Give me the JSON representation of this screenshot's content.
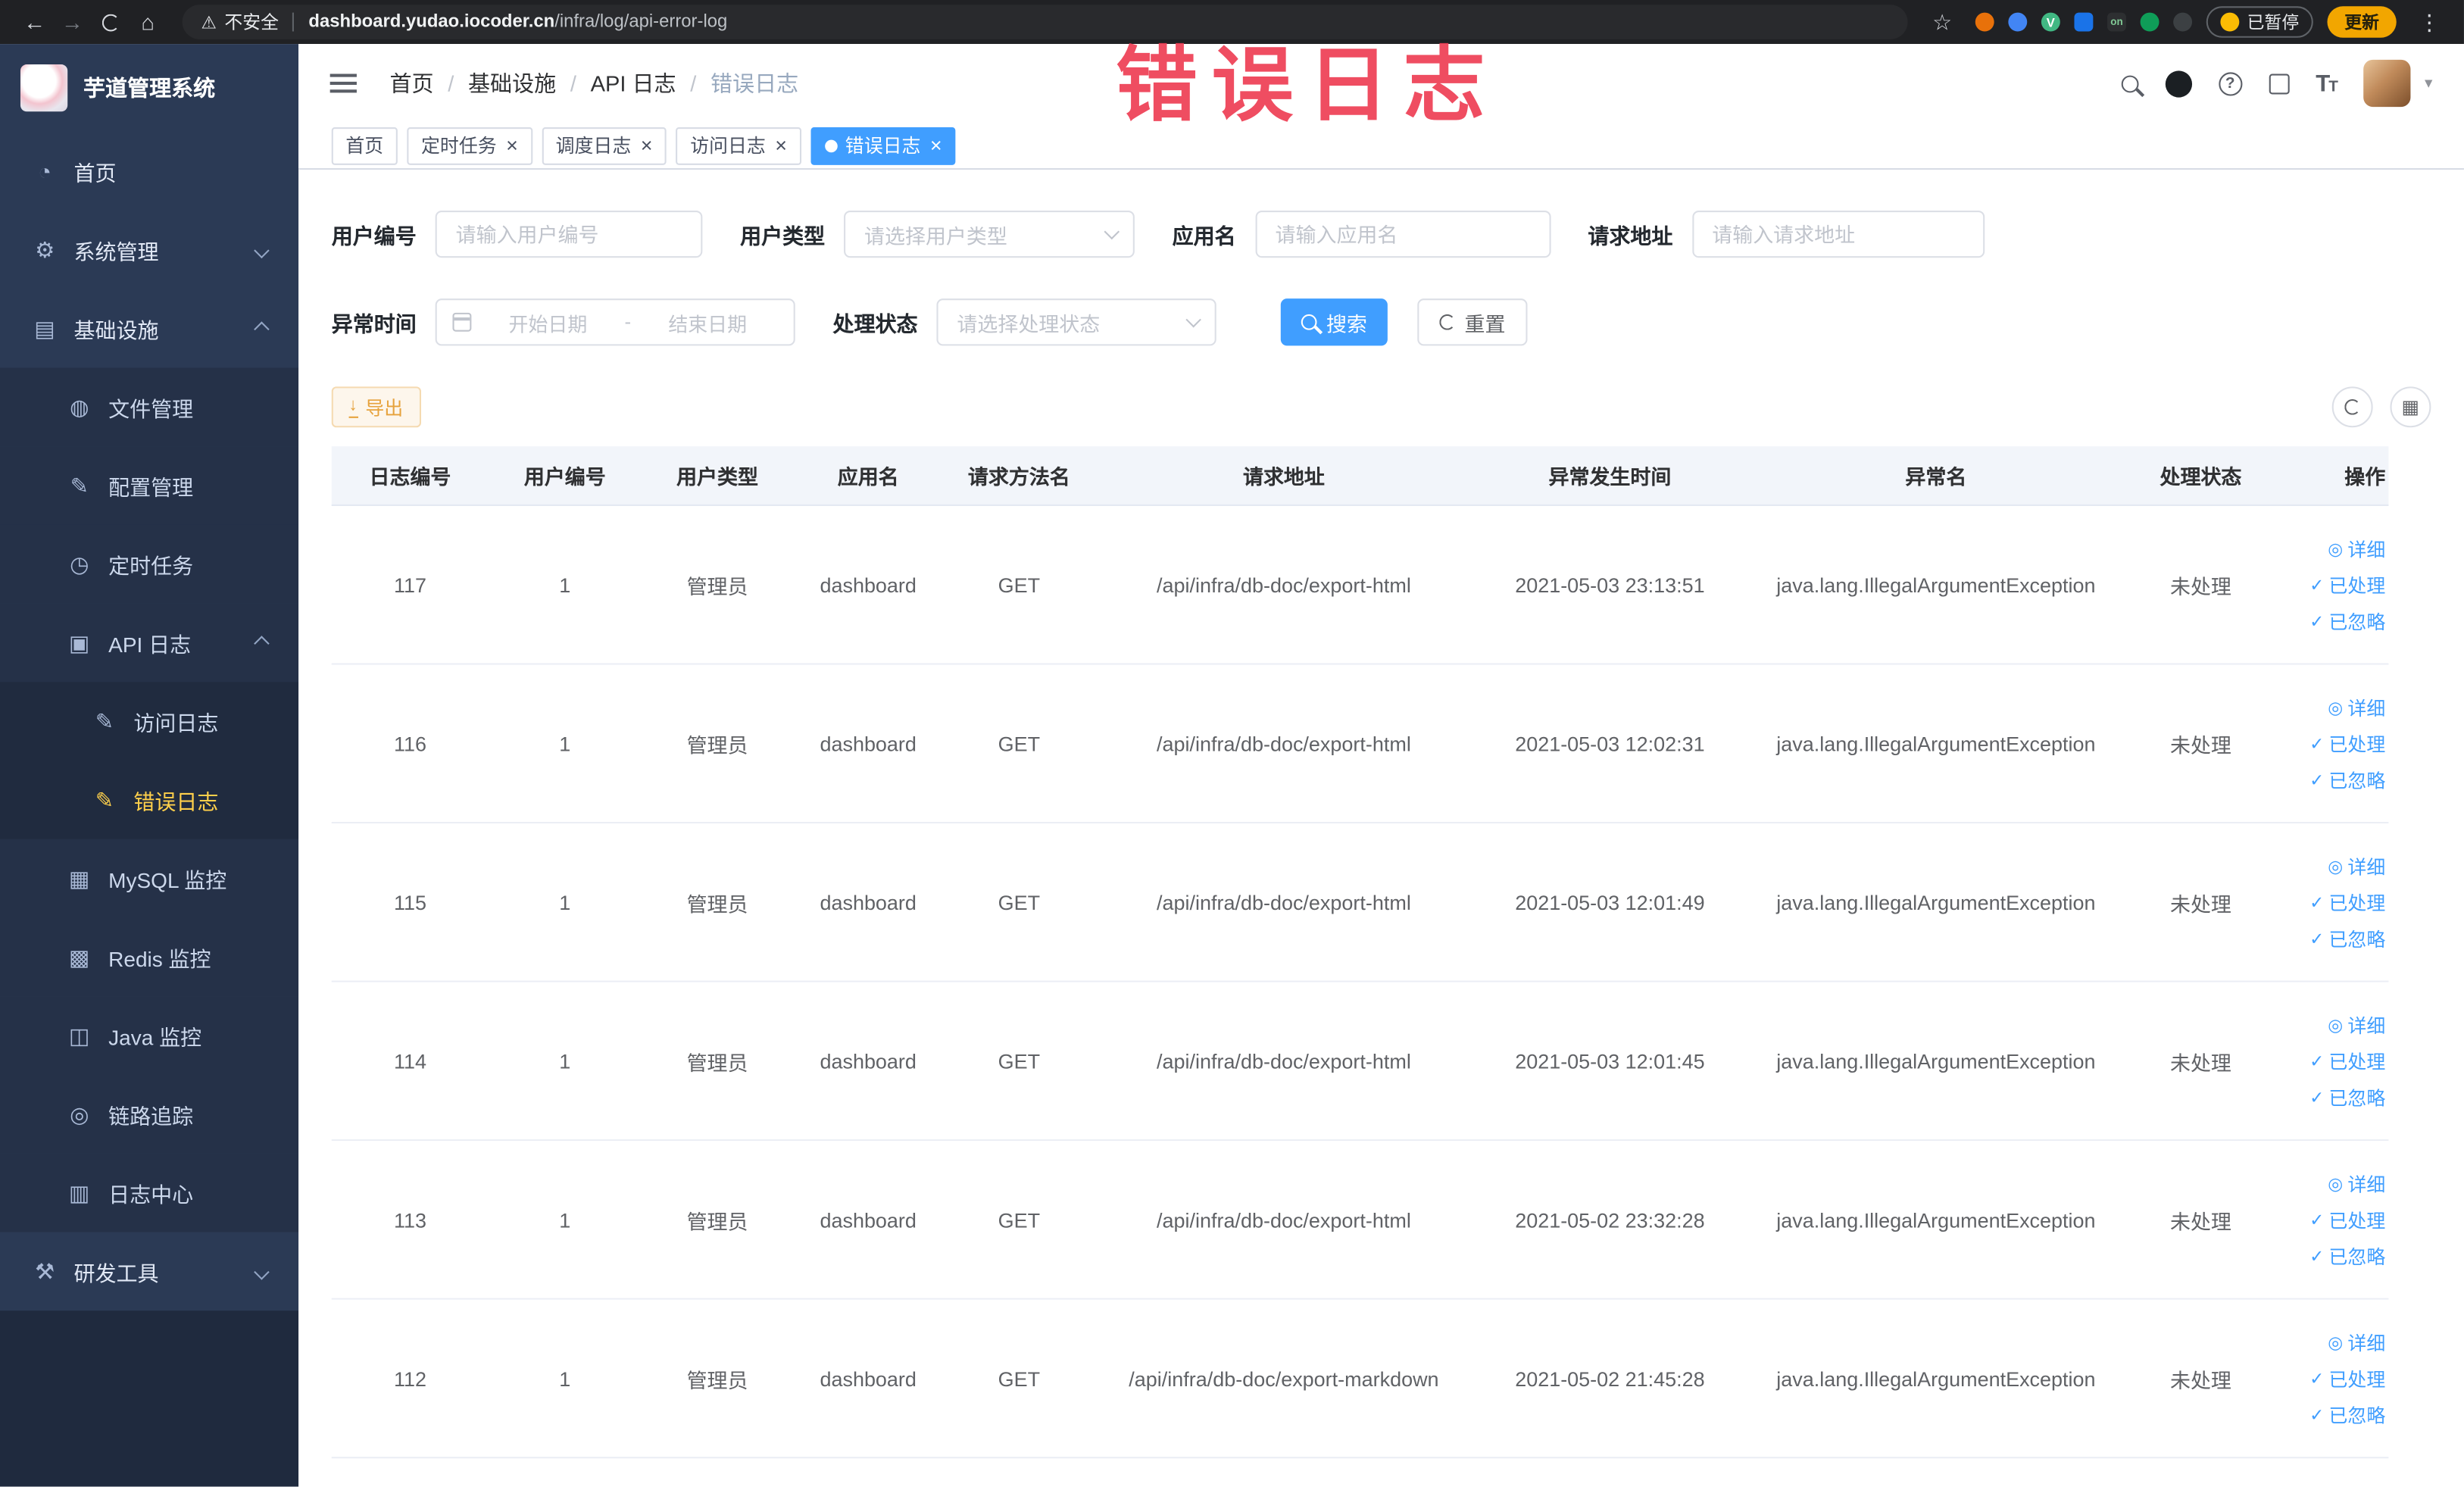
{
  "browser": {
    "security_label": "不安全",
    "url_domain": "dashboard.yudao.iocoder.cn",
    "url_path": "/infra/log/api-error-log",
    "on_badge": "on",
    "paused_label": "已暂停",
    "update_label": "更新"
  },
  "sidebar": {
    "logo_text": "芋道管理系统",
    "items": [
      {
        "id": "home",
        "label": "首页",
        "icon": "dashboard",
        "level": 1
      },
      {
        "id": "system-management",
        "label": "系统管理",
        "icon": "gear",
        "level": 1,
        "arrow": "down"
      },
      {
        "id": "infrastructure",
        "label": "基础设施",
        "icon": "monitor",
        "level": 1,
        "arrow": "up"
      },
      {
        "id": "file-management",
        "label": "文件管理",
        "icon": "file",
        "level": 2
      },
      {
        "id": "config-management",
        "label": "配置管理",
        "icon": "config",
        "level": 2
      },
      {
        "id": "scheduled-tasks",
        "label": "定时任务",
        "icon": "timer",
        "level": 2
      },
      {
        "id": "api-log",
        "label": "API 日志",
        "icon": "api",
        "level": 2,
        "arrow": "up"
      },
      {
        "id": "access-log",
        "label": "访问日志",
        "icon": "log",
        "level": 3
      },
      {
        "id": "error-log",
        "label": "错误日志",
        "icon": "log",
        "level": 3,
        "active": true
      },
      {
        "id": "mysql-monitor",
        "label": "MySQL 监控",
        "icon": "mysql",
        "level": 2
      },
      {
        "id": "redis-monitor",
        "label": "Redis 监控",
        "icon": "redis",
        "level": 2
      },
      {
        "id": "java-monitor",
        "label": "Java 监控",
        "icon": "java",
        "level": 2
      },
      {
        "id": "link-trace",
        "label": "链路追踪",
        "icon": "trace",
        "level": 2
      },
      {
        "id": "log-center",
        "label": "日志中心",
        "icon": "center",
        "level": 2
      },
      {
        "id": "dev-tools",
        "label": "研发工具",
        "icon": "tools",
        "level": 1,
        "arrow": "down"
      }
    ]
  },
  "breadcrumb": {
    "items": [
      "首页",
      "基础设施",
      "API 日志",
      "错误日志"
    ]
  },
  "tags": {
    "items": [
      {
        "label": "首页",
        "closable": false
      },
      {
        "label": "定时任务",
        "closable": true
      },
      {
        "label": "调度日志",
        "closable": true
      },
      {
        "label": "访问日志",
        "closable": true
      },
      {
        "label": "错误日志",
        "closable": true,
        "active": true
      }
    ]
  },
  "filters": {
    "user_id": {
      "label": "用户编号",
      "placeholder": "请输入用户编号"
    },
    "user_type": {
      "label": "用户类型",
      "placeholder": "请选择用户类型"
    },
    "app_name": {
      "label": "应用名",
      "placeholder": "请输入应用名"
    },
    "request_url": {
      "label": "请求地址",
      "placeholder": "请输入请求地址"
    },
    "exception_time": {
      "label": "异常时间",
      "start_placeholder": "开始日期",
      "separator": "-",
      "end_placeholder": "结束日期"
    },
    "process_status": {
      "label": "处理状态",
      "placeholder": "请选择处理状态"
    },
    "search_button": "搜索",
    "reset_button": "重置"
  },
  "toolbar": {
    "export_label": "导出"
  },
  "table": {
    "columns": [
      {
        "key": "id",
        "label": "日志编号"
      },
      {
        "key": "user_id",
        "label": "用户编号"
      },
      {
        "key": "user_type",
        "label": "用户类型"
      },
      {
        "key": "app",
        "label": "应用名"
      },
      {
        "key": "method",
        "label": "请求方法名"
      },
      {
        "key": "url",
        "label": "请求地址"
      },
      {
        "key": "time",
        "label": "异常发生时间"
      },
      {
        "key": "exception",
        "label": "异常名"
      },
      {
        "key": "status",
        "label": "处理状态"
      },
      {
        "key": "actions",
        "label": "操作"
      }
    ],
    "row_actions": [
      {
        "name": "detail",
        "label": "详细",
        "icon": "eye",
        "glyph": "◎"
      },
      {
        "name": "processed",
        "label": "已处理",
        "icon": "check",
        "glyph": "✓"
      },
      {
        "name": "ignored",
        "label": "已忽略",
        "icon": "check",
        "glyph": "✓"
      }
    ],
    "rows": [
      {
        "id": "117",
        "user_id": "1",
        "user_type": "管理员",
        "app": "dashboard",
        "method": "GET",
        "url": "/api/infra/db-doc/export-html",
        "time": "2021-05-03 23:13:51",
        "exception": "java.lang.IllegalArgumentException",
        "status": "未处理"
      },
      {
        "id": "116",
        "user_id": "1",
        "user_type": "管理员",
        "app": "dashboard",
        "method": "GET",
        "url": "/api/infra/db-doc/export-html",
        "time": "2021-05-03 12:02:31",
        "exception": "java.lang.IllegalArgumentException",
        "status": "未处理"
      },
      {
        "id": "115",
        "user_id": "1",
        "user_type": "管理员",
        "app": "dashboard",
        "method": "GET",
        "url": "/api/infra/db-doc/export-html",
        "time": "2021-05-03 12:01:49",
        "exception": "java.lang.IllegalArgumentException",
        "status": "未处理"
      },
      {
        "id": "114",
        "user_id": "1",
        "user_type": "管理员",
        "app": "dashboard",
        "method": "GET",
        "url": "/api/infra/db-doc/export-html",
        "time": "2021-05-03 12:01:45",
        "exception": "java.lang.IllegalArgumentException",
        "status": "未处理"
      },
      {
        "id": "113",
        "user_id": "1",
        "user_type": "管理员",
        "app": "dashboard",
        "method": "GET",
        "url": "/api/infra/db-doc/export-html",
        "time": "2021-05-02 23:32:28",
        "exception": "java.lang.IllegalArgumentException",
        "status": "未处理"
      },
      {
        "id": "112",
        "user_id": "1",
        "user_type": "管理员",
        "app": "dashboard",
        "method": "GET",
        "url": "/api/infra/db-doc/export-markdown",
        "time": "2021-05-02 21:45:28",
        "exception": "java.lang.IllegalArgumentException",
        "status": "未处理"
      }
    ]
  },
  "annotation": {
    "text": "错误日志"
  },
  "colors": {
    "accent": "#409eff",
    "sidebar_active_text": "#ffd04b",
    "warning": "#e6a23c",
    "annotation": "#ee3e54"
  }
}
